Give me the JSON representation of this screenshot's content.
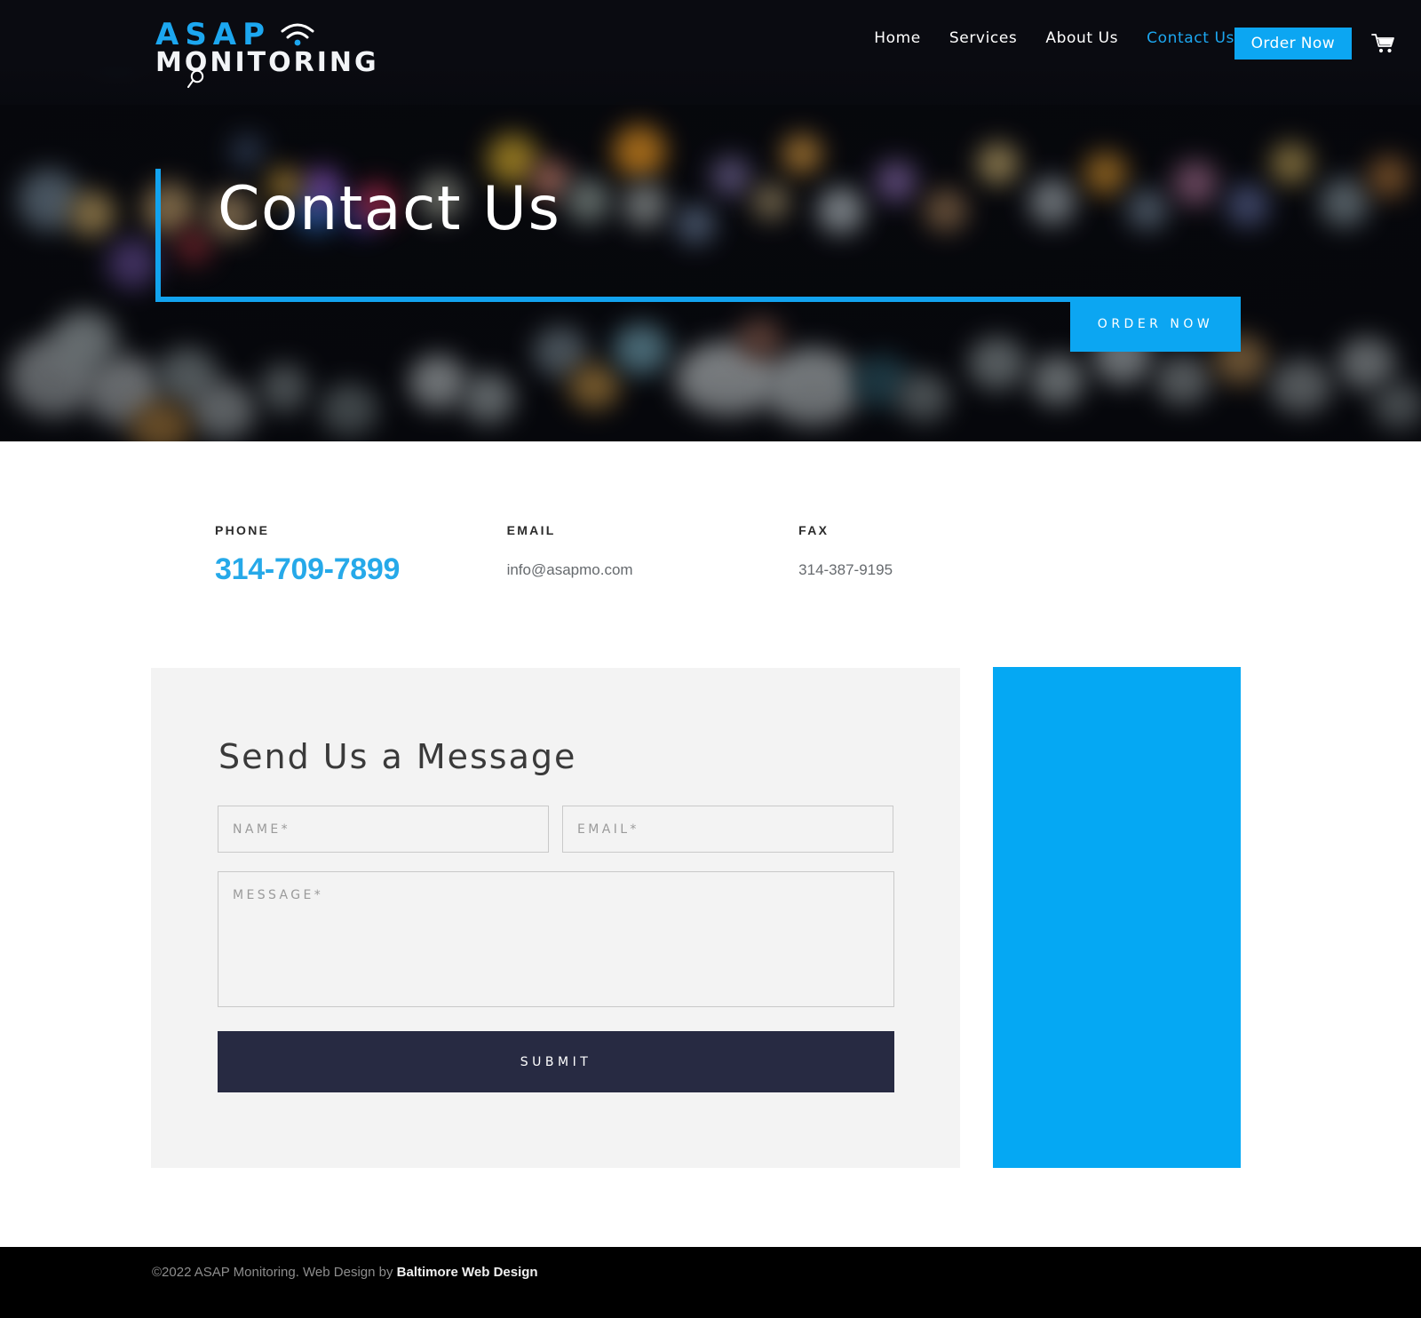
{
  "brand": {
    "name_part1": "ASAP",
    "name_part2": "MONITORING",
    "accent_color": "#0ca6f2"
  },
  "nav": {
    "links": [
      {
        "label": "Home",
        "active": false
      },
      {
        "label": "Services",
        "active": false
      },
      {
        "label": "About Us",
        "active": false
      },
      {
        "label": "Contact Us",
        "active": true
      }
    ],
    "order_button": "Order Now",
    "cart_icon": "shopping-cart-icon"
  },
  "hero": {
    "title": "Contact Us",
    "cta_label": "ORDER NOW"
  },
  "contact": {
    "columns": [
      {
        "label": "PHONE",
        "value": "314-709-7899"
      },
      {
        "label": "EMAIL",
        "value": "info@asapmo.com"
      },
      {
        "label": "FAX",
        "value": "314-387-9195"
      }
    ]
  },
  "form": {
    "title": "Send Us a Message",
    "name_placeholder": "NAME*",
    "name_value": "",
    "email_placeholder": "EMAIL*",
    "email_value": "",
    "message_placeholder": "MESSAGE*",
    "message_value": "",
    "submit_label": "SUBMIT"
  },
  "footer": {
    "copyright": "©2022 ASAP Monitoring. Web Design by ",
    "credit": "Baltimore Web Design"
  }
}
